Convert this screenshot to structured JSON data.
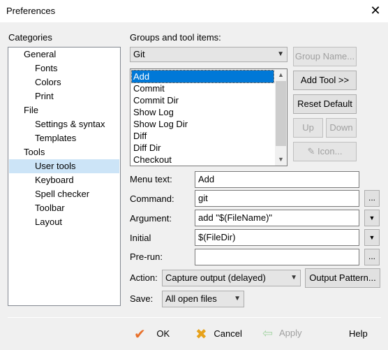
{
  "window": {
    "title": "Preferences",
    "close_glyph": "✕"
  },
  "categories": {
    "label": "Categories",
    "items": [
      {
        "label": "General",
        "level": 1
      },
      {
        "label": "Fonts",
        "level": 2
      },
      {
        "label": "Colors",
        "level": 2
      },
      {
        "label": "Print",
        "level": 2
      },
      {
        "label": "File",
        "level": 1
      },
      {
        "label": "Settings & syntax",
        "level": 2
      },
      {
        "label": "Templates",
        "level": 2
      },
      {
        "label": "Tools",
        "level": 1
      },
      {
        "label": "User tools",
        "level": 2,
        "selected": true
      },
      {
        "label": "Keyboard",
        "level": 2
      },
      {
        "label": "Spell checker",
        "level": 2
      },
      {
        "label": "Toolbar",
        "level": 2
      },
      {
        "label": "Layout",
        "level": 2
      }
    ]
  },
  "groups": {
    "label": "Groups and tool items:",
    "selected_group": "Git",
    "items": [
      "Add",
      "Commit",
      "Commit Dir",
      "Show Log",
      "Show Log Dir",
      "Diff",
      "Diff Dir",
      "Checkout"
    ],
    "selected_item": "Add"
  },
  "buttons": {
    "group_name": "Group Name...",
    "add_tool": "Add Tool >>",
    "reset_default": "Reset Default",
    "up": "Up",
    "down": "Down",
    "icon": "Icon...",
    "output_pattern": "Output Pattern...",
    "browse": "...",
    "ok": "OK",
    "cancel": "Cancel",
    "apply": "Apply",
    "help": "Help"
  },
  "form": {
    "menu_text_label": "Menu text:",
    "menu_text_value": "Add",
    "command_label": "Command:",
    "command_value": "git",
    "argument_label": "Argument:",
    "argument_value": "add \"$(FileName)\"",
    "initial_label": "Initial",
    "initial_value": "$(FileDir)",
    "prerun_label": "Pre-run:",
    "prerun_value": "",
    "action_label": "Action:",
    "action_value": "Capture output (delayed)",
    "save_label": "Save:",
    "save_value": "All open files"
  },
  "icons": {
    "ok": "checkmark-icon",
    "cancel": "x-mark-icon",
    "apply": "back-arrow-icon",
    "dropdown": "chevron-down-icon"
  }
}
